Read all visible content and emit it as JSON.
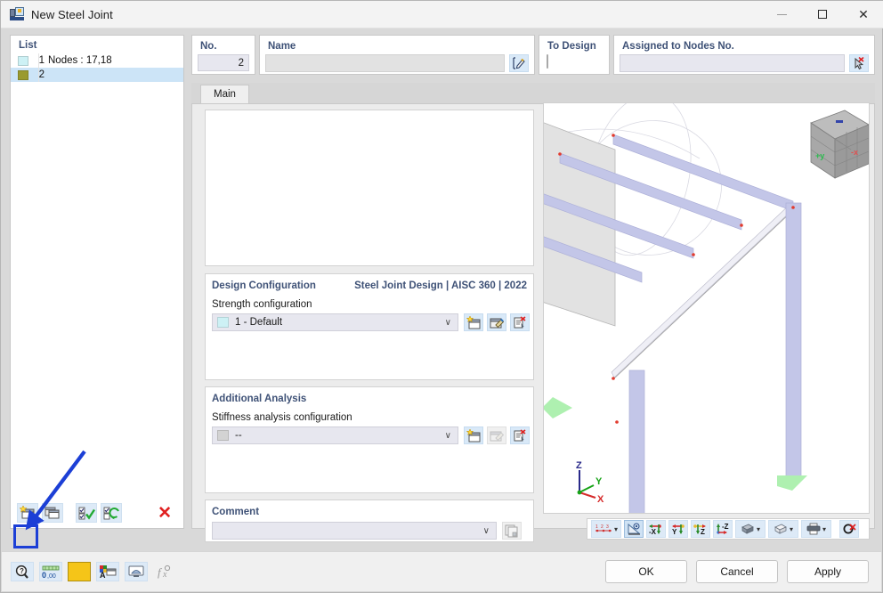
{
  "window": {
    "title": "New Steel Joint",
    "icon": "steel-joint-icon",
    "minimize_label": "—",
    "maximize_label": "",
    "close_label": "✕"
  },
  "list_panel": {
    "header": "List",
    "rows": [
      {
        "swatch_color": "#cdf1f5",
        "number": "1",
        "text": "Nodes : 17,18",
        "selected": false
      },
      {
        "swatch_color": "#9a9a2e",
        "number": "2",
        "text": "",
        "selected": true
      }
    ],
    "toolbar": {
      "new_label": "new-joint",
      "copy_label": "copy-joint",
      "check_all_label": "check-all",
      "refresh_label": "refresh-selection",
      "delete_label": "✕"
    }
  },
  "header_fields": {
    "no": {
      "label": "No.",
      "value": "2"
    },
    "name": {
      "label": "Name",
      "value": "",
      "placeholder": ""
    },
    "to_design": {
      "label": "To Design",
      "checked": false
    },
    "assigned_nodes": {
      "label": "Assigned to Nodes No.",
      "value": "",
      "placeholder": ""
    }
  },
  "tabs": [
    {
      "label": "Main",
      "active": true
    }
  ],
  "design_configuration": {
    "title": "Design Configuration",
    "standard": "Steel Joint Design | AISC 360 | 2022",
    "field_label": "Strength configuration",
    "value": "1 - Default",
    "swatch_color": "#cdf1f5",
    "caret": "∨"
  },
  "additional_analysis": {
    "title": "Additional Analysis",
    "field_label": "Stiffness analysis configuration",
    "value": "--",
    "swatch_color": "#d3d3d3",
    "caret": "∨"
  },
  "comment": {
    "title": "Comment",
    "value": "",
    "caret": "∨"
  },
  "viewport": {
    "cube_labels": {
      "y": "+y",
      "x": "-x"
    },
    "axes": {
      "z": "Z",
      "y": "Y",
      "x": "X"
    },
    "toolbar": [
      {
        "name": "numbering-dropdown",
        "caret": "▾"
      },
      {
        "name": "render-mode",
        "caret": ""
      },
      {
        "name": "view-negative-x",
        "label": "-X"
      },
      {
        "name": "view-y",
        "label": "Y"
      },
      {
        "name": "view-z",
        "label": "Z"
      },
      {
        "name": "view-negative-z",
        "label": "-Z"
      },
      {
        "name": "shading-dropdown",
        "caret": "▾"
      },
      {
        "name": "wireframe-dropdown",
        "caret": "▾"
      },
      {
        "name": "print-dropdown",
        "caret": "▾"
      },
      {
        "name": "zoom-reset",
        "caret": ""
      }
    ]
  },
  "bottom_bar": {
    "left_buttons": [
      {
        "name": "help-button"
      },
      {
        "name": "units-button"
      },
      {
        "name": "color-button",
        "color": "#f5c518"
      },
      {
        "name": "display-properties-button"
      },
      {
        "name": "view-settings-button"
      },
      {
        "name": "formula-button"
      }
    ],
    "ok_label": "OK",
    "cancel_label": "Cancel",
    "apply_label": "Apply"
  },
  "colors": {
    "accent_heading": "#3f5277",
    "selection": "#cce4f7",
    "field_bg": "#e7e7ef",
    "toolbar_btn": "#ddeaf7",
    "annotation": "#1c3fd6",
    "danger": "#e02020",
    "member": "#c3c6e8"
  }
}
